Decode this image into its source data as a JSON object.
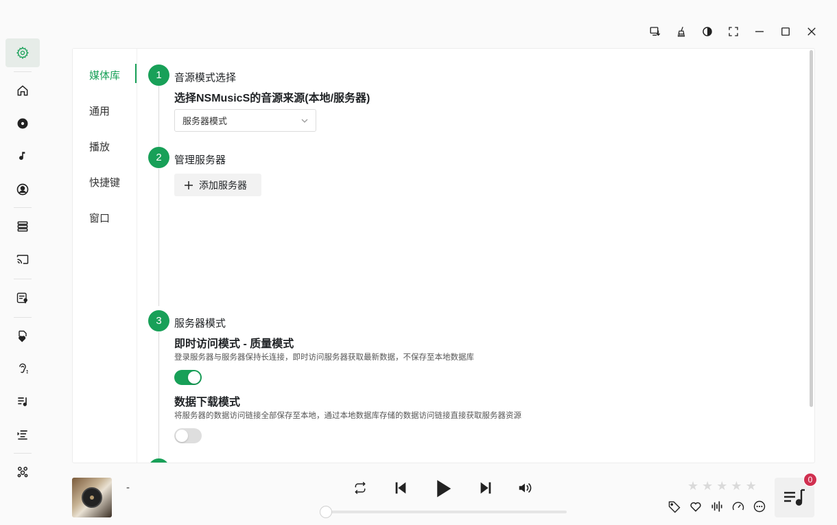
{
  "colors": {
    "accent": "#18a058",
    "badge": "#d03050"
  },
  "sidebar": {
    "items": [
      {
        "name": "settings",
        "icon": "gear-icon",
        "active": true
      },
      {
        "name": "home",
        "icon": "home-icon"
      },
      {
        "name": "albums",
        "icon": "disc-icon"
      },
      {
        "name": "songs",
        "icon": "music-note-icon"
      },
      {
        "name": "artists",
        "icon": "person-circle-icon"
      },
      {
        "name": "library",
        "icon": "library-stack-icon"
      },
      {
        "name": "cast",
        "icon": "cast-icon"
      },
      {
        "name": "lyrics",
        "icon": "lyrics-mic-icon"
      },
      {
        "name": "favorites",
        "icon": "heart-file-icon"
      },
      {
        "name": "listen",
        "icon": "ear-icon"
      },
      {
        "name": "playlists",
        "icon": "playlist-music-icon"
      },
      {
        "name": "queue",
        "icon": "list-indent-icon"
      },
      {
        "name": "more",
        "icon": "apps-cluster-icon"
      }
    ]
  },
  "window_controls": [
    {
      "name": "download",
      "icon": "download-screen-icon"
    },
    {
      "name": "clean",
      "icon": "broom-icon"
    },
    {
      "name": "theme",
      "icon": "contrast-icon"
    },
    {
      "name": "fullscreen",
      "icon": "fullscreen-icon"
    },
    {
      "name": "minimize",
      "icon": "minimize-icon"
    },
    {
      "name": "maximize",
      "icon": "maximize-icon"
    },
    {
      "name": "close",
      "icon": "close-icon"
    }
  ],
  "settings": {
    "tabs": [
      "媒体库",
      "通用",
      "播放",
      "快捷键",
      "窗口"
    ],
    "active_tab": "媒体库",
    "steps": [
      {
        "number": "1",
        "title": "音源模式选择",
        "subtitle": "选择NSMusicS的音源来源(本地/服务器)",
        "select_value": "服务器模式"
      },
      {
        "number": "2",
        "title": "管理服务器",
        "add_button": "添加服务器"
      },
      {
        "number": "3",
        "title": "服务器模式",
        "options": [
          {
            "title": "即时访问模式 - 质量模式",
            "desc": "登录服务器与服务器保持长连接，即时访问服务器获取最新数据，不保存至本地数据库",
            "enabled": true
          },
          {
            "title": "数据下载模式",
            "desc": "将服务器的数据访问链接全部保存至本地，通过本地数据库存储的数据访问链接直接获取服务器资源",
            "enabled": false
          }
        ]
      }
    ]
  },
  "player": {
    "title": "-",
    "progress": 0,
    "rating": 0,
    "rating_max": 5,
    "queue_count": "0",
    "controls": [
      "repeat-icon",
      "previous-icon",
      "play-icon",
      "next-icon",
      "volume-icon"
    ],
    "bottom_icons": [
      "tag-icon",
      "heart-icon",
      "equalizer-icon",
      "speed-gauge-icon",
      "more-circle-icon"
    ]
  }
}
